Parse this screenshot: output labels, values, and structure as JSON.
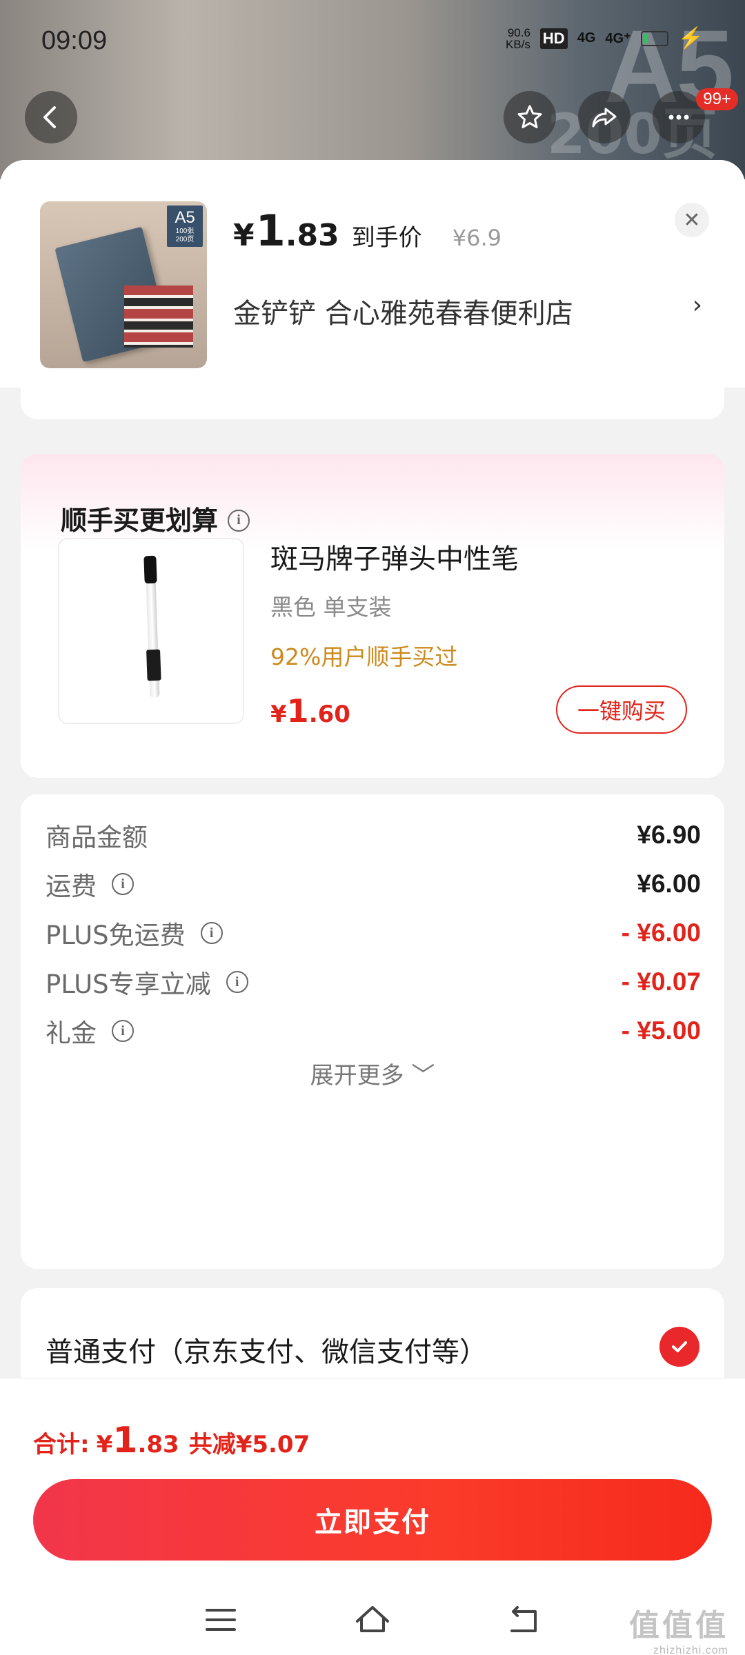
{
  "status_bar": {
    "time": "09:09",
    "net_speed_value": "90.6",
    "net_speed_unit": "KB/s",
    "hd_tag": "HD",
    "sig1": "4G",
    "sig2": "4G⁺"
  },
  "header_actions": {
    "badge": "99+"
  },
  "background_text": {
    "big": "A5",
    "sub": "200页"
  },
  "product": {
    "thumb_badge": "A5",
    "thumb_badge_sub1": "100张",
    "thumb_badge_sub2": "200页",
    "price_symbol": "¥",
    "price_int": "1",
    "price_dec": ".83",
    "price_label": "到手价",
    "original_price": "¥6.9",
    "store_name": "金铲铲  合心雅苑春春便利店",
    "store_chevron": "›",
    "close": "✕"
  },
  "addon": {
    "title": "顺手买更划算",
    "info": "i",
    "name": "斑马牌子弹头中性笔",
    "spec": "黑色 单支装",
    "stat": "92%用户顺手买过",
    "price_symbol": "¥",
    "price_int": "1",
    "price_dec": ".60",
    "buy_label": "一键购买"
  },
  "price_breakdown": {
    "rows": [
      {
        "label": "商品金额",
        "value": "¥6.90",
        "info": false
      },
      {
        "label": "运费",
        "value": "¥6.00",
        "info": true
      },
      {
        "label": "PLUS免运费",
        "value": "- ¥6.00",
        "info": true
      },
      {
        "label": "PLUS专享立减",
        "value": "- ¥0.07",
        "info": true
      },
      {
        "label": "礼金",
        "value": "- ¥5.00",
        "info": true
      }
    ],
    "info_glyph": "i",
    "expand_label": "展开更多 ﹀"
  },
  "payment": {
    "method_label": "普通支付（京东支付、微信支付等）"
  },
  "footer": {
    "total_label": "合计:",
    "total_symbol": "¥",
    "total_int": "1",
    "total_dec": ".83",
    "discount": "共减¥5.07",
    "pay_button": "立即支付"
  },
  "watermark": {
    "main": "值值值",
    "url": "zhizhizhi.com"
  },
  "colors": {
    "accent_red": "#e2231a",
    "pay_button": "#f52a1d",
    "addon_stat": "#cc8a1e"
  }
}
